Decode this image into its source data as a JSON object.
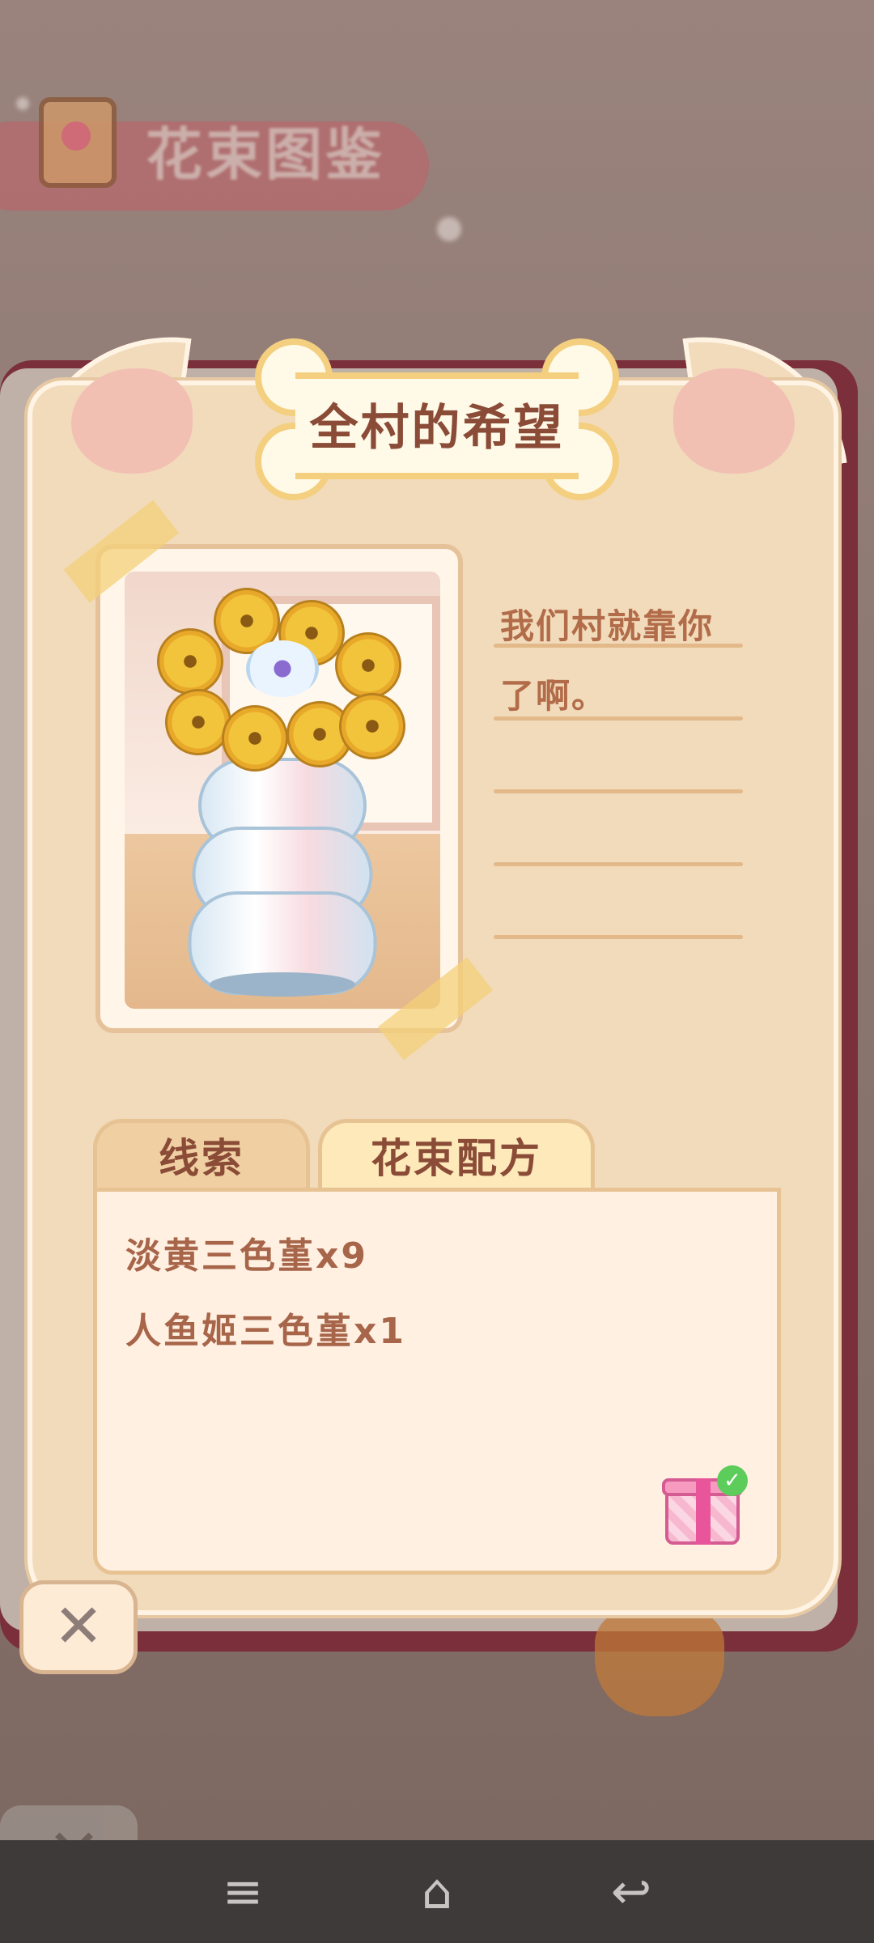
{
  "background": {
    "title": "花束图鉴",
    "close_glyph": "✕"
  },
  "card": {
    "title": "全村的希望",
    "note_lines": [
      "我们村就靠你",
      "了啊。",
      "",
      "",
      ""
    ],
    "tabs": [
      {
        "label": "线索",
        "active": false
      },
      {
        "label": "花束配方",
        "active": true
      }
    ],
    "ingredients": [
      "淡黄三色堇x9",
      "人鱼姬三色堇x1"
    ],
    "gift_check_glyph": "✓",
    "close_glyph": "✕"
  },
  "icons": {
    "gift": "gift-box-icon",
    "check": "check-icon",
    "close": "close-icon",
    "menu": "menu-icon",
    "home": "home-icon",
    "back": "back-icon"
  },
  "nav": {
    "menu_glyph": "≡",
    "home_glyph": "⌂",
    "back_glyph": "↩"
  },
  "colors": {
    "card": "#f1dbbb",
    "title_text": "#8a4b37",
    "accent_gold": "#f3cf7f",
    "ear_pink": "#f2bfb3",
    "nav_bar": "#3e3a39"
  }
}
